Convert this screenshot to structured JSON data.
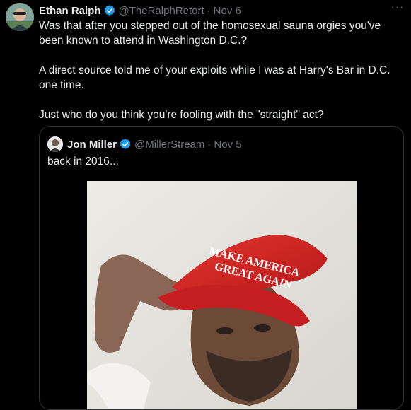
{
  "tweet": {
    "author_name": "Ethan Ralph",
    "handle": "@TheRalphRetort",
    "separator": "·",
    "date": "Nov 6",
    "more_label": "···",
    "paragraphs": [
      "Was that after you stepped out of the homosexual sauna orgies you've been known to attend in Washington D.C.?",
      "A direct source told me of your exploits while I was at Harry's Bar in D.C. one time.",
      "Just who do you think you're fooling with the \"straight\" act?"
    ]
  },
  "quoted_tweet": {
    "author_name": "Jon Miller",
    "handle": "@MillerStream",
    "separator": "·",
    "date": "Nov 5",
    "text": "back in 2016...",
    "hat_text_line1": "MAKE AMERICA",
    "hat_text_line2": "GREAT AGAIN"
  },
  "colors": {
    "background": "#000000",
    "text_primary": "#e7e9ea",
    "text_secondary": "#71767b",
    "verified_badge": "#1d9bf0",
    "border": "#2f3336",
    "hat_red": "#d21f1f"
  },
  "icons": {
    "verified": "verified-badge-icon",
    "more": "more-options-icon"
  }
}
